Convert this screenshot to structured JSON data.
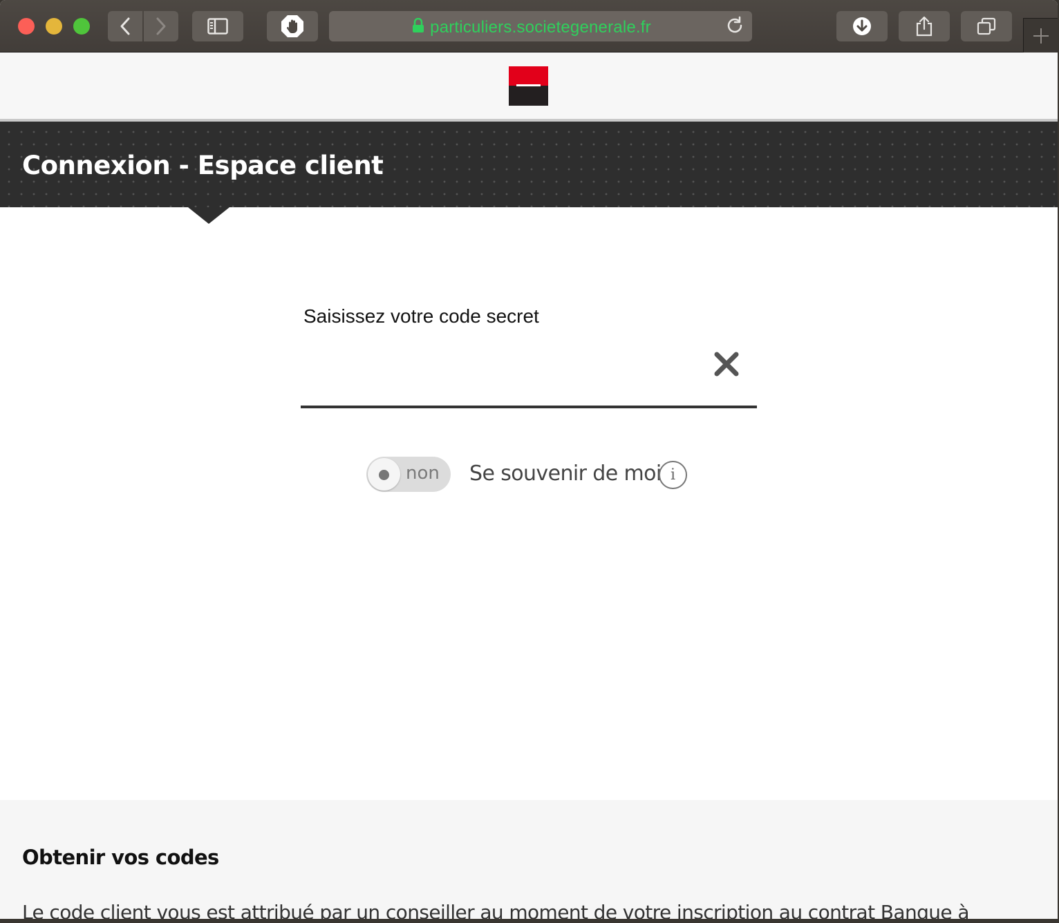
{
  "browser": {
    "url": "particuliers.societegenerale.fr",
    "url_color": "#2fd05c"
  },
  "icons": {
    "back": "chevron-left-icon",
    "forward": "chevron-right-icon",
    "sidebar": "sidebar-icon",
    "blocker": "hand-stop-icon",
    "lock": "lock-icon",
    "reload": "reload-icon",
    "download": "download-icon",
    "share": "share-icon",
    "tabs": "tabs-overview-icon",
    "new_tab": "plus-icon",
    "clear": "close-icon",
    "info": "info-icon"
  },
  "brand": {
    "red": "#e2001a",
    "black": "#231f20"
  },
  "banner": {
    "title": "Connexion - Espace client"
  },
  "form": {
    "code_label": "Saisissez votre code secret",
    "code_value": "",
    "remember_toggle_state": "non",
    "remember_label": "Se souvenir de moi",
    "info_glyph": "i"
  },
  "footer": {
    "title": "Obtenir vos codes",
    "text": "Le code client vous est attribué par un conseiller au moment de votre inscription au contrat Banque à"
  }
}
